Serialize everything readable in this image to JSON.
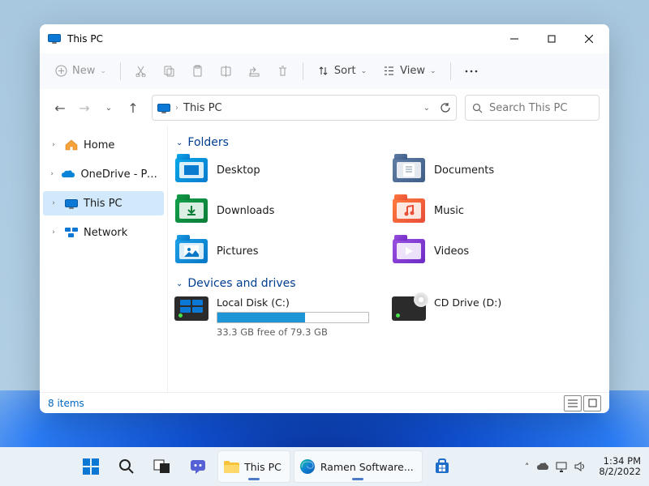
{
  "window": {
    "title": "This PC",
    "toolbar": {
      "new": "New",
      "sort": "Sort",
      "view": "View"
    },
    "address": {
      "path": "This PC"
    },
    "search": {
      "placeholder": "Search This PC"
    }
  },
  "sidebar": [
    {
      "label": "Home",
      "icon": "home"
    },
    {
      "label": "OneDrive - Personal",
      "icon": "onedrive"
    },
    {
      "label": "This PC",
      "icon": "thispc",
      "selected": true
    },
    {
      "label": "Network",
      "icon": "network"
    }
  ],
  "sections": {
    "folders": {
      "title": "Folders",
      "items": [
        {
          "label": "Desktop",
          "color": "f-desktop"
        },
        {
          "label": "Documents",
          "color": "f-documents"
        },
        {
          "label": "Downloads",
          "color": "f-downloads"
        },
        {
          "label": "Music",
          "color": "f-music"
        },
        {
          "label": "Pictures",
          "color": "f-pictures"
        },
        {
          "label": "Videos",
          "color": "f-videos"
        }
      ]
    },
    "drives": {
      "title": "Devices and drives",
      "items": [
        {
          "label": "Local Disk (C:)",
          "free_text": "33.3 GB free of 79.3 GB",
          "fill_pct": 58
        },
        {
          "label": "CD Drive (D:)",
          "cd": true
        }
      ]
    }
  },
  "status": {
    "count": "8 items"
  },
  "taskbar": {
    "apps": [
      {
        "name": "start",
        "active": false
      },
      {
        "name": "search",
        "active": false
      },
      {
        "name": "taskview",
        "active": false
      },
      {
        "name": "chat",
        "active": false
      },
      {
        "name": "explorer",
        "active": true,
        "label": "This PC"
      },
      {
        "name": "edge",
        "active": true,
        "label": "Ramen Software..."
      },
      {
        "name": "store",
        "active": false
      }
    ],
    "time": "1:34 PM",
    "date": "8/2/2022"
  }
}
